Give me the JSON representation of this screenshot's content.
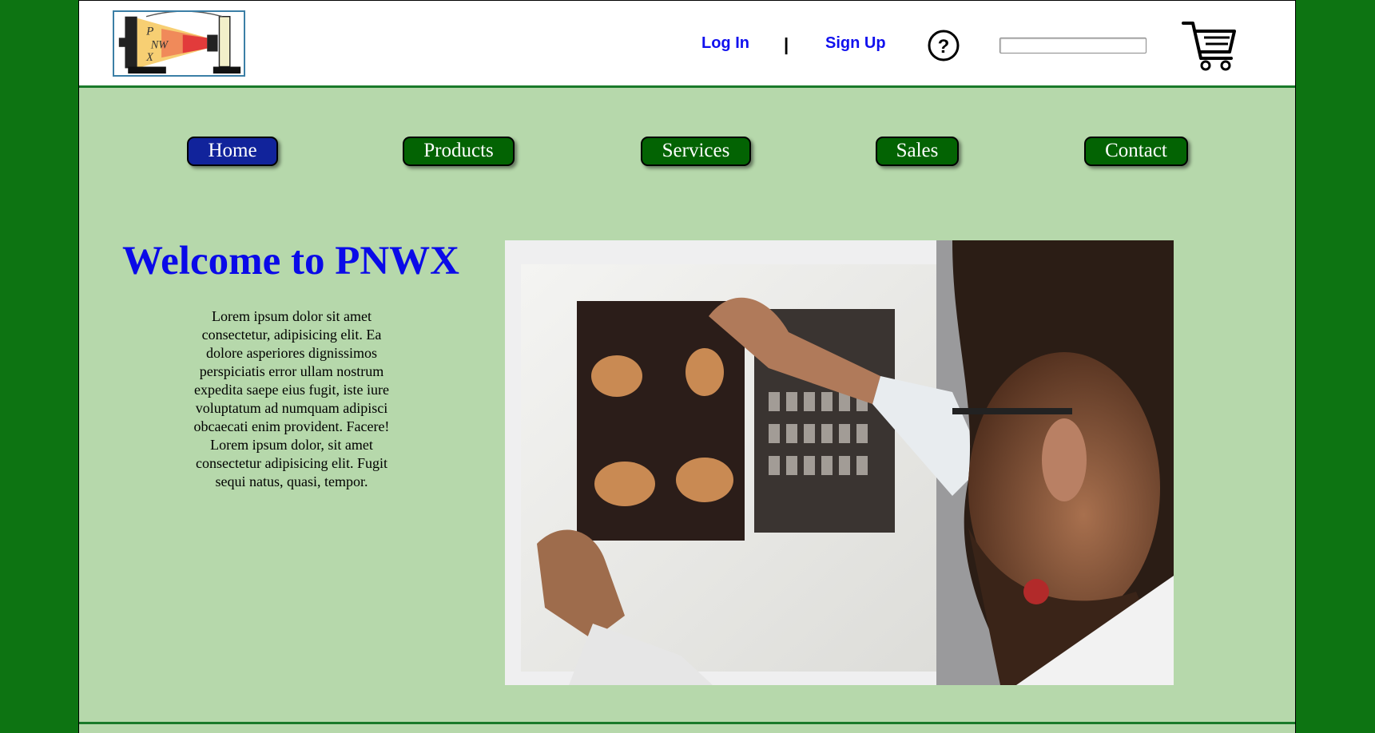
{
  "header": {
    "login_label": "Log In",
    "separator": "|",
    "signup_label": "Sign Up",
    "help_icon": "question-circle-icon",
    "search": {
      "value": "",
      "placeholder": ""
    },
    "cart_icon": "shopping-cart-icon"
  },
  "nav": {
    "items": [
      {
        "label": "Home",
        "active": true
      },
      {
        "label": "Products",
        "active": false
      },
      {
        "label": "Services",
        "active": false
      },
      {
        "label": "Sales",
        "active": false
      },
      {
        "label": "Contact",
        "active": false
      }
    ]
  },
  "main": {
    "title": "Welcome to PNWX",
    "intro": "Lorem ipsum dolor sit amet consectetur, adipisicing elit. Ea dolore asperiores dignissimos perspiciatis error ullam nostrum expedita saepe eius fugit, iste iure voluptatum ad numquam adipisci obcaecati enim provident. Facere! Lorem ipsum dolor, sit amet consectetur adipisicing elit. Fugit sequi natus, quasi, tempor."
  },
  "colors": {
    "outer_bg": "#0d7412",
    "page_bg": "#b6d8ab",
    "nav_active": "#11239b",
    "nav_default": "#036303",
    "link": "#1111ee",
    "title": "#0a0ae8"
  }
}
